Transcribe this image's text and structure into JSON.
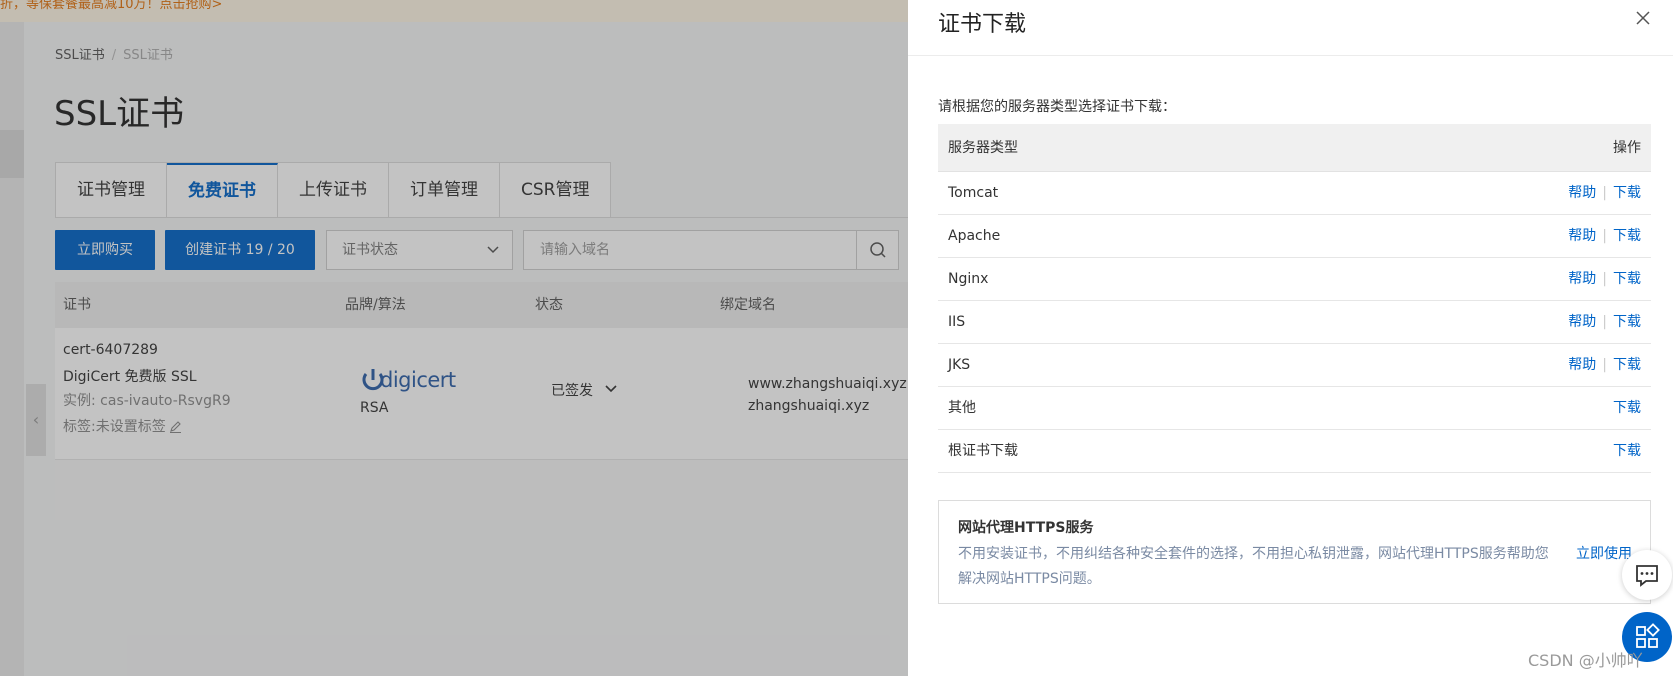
{
  "promo_banner": "折，等保套餐最高减10万！点击抢购>",
  "breadcrumb": {
    "root": "SSL证书",
    "separator": "/",
    "current": "SSL证书"
  },
  "page_title": "SSL证书",
  "tabs": [
    {
      "label": "证书管理",
      "active": false
    },
    {
      "label": "免费证书",
      "active": true
    },
    {
      "label": "上传证书",
      "active": false
    },
    {
      "label": "订单管理",
      "active": false
    },
    {
      "label": "CSR管理",
      "active": false
    }
  ],
  "toolbar": {
    "buy_label": "立即购买",
    "create_label": "创建证书 19 / 20",
    "status_select": "证书状态",
    "search_placeholder": "请输入域名"
  },
  "cert_table": {
    "headers": {
      "cert": "证书",
      "brand": "品牌/算法",
      "status": "状态",
      "domain": "绑定域名"
    },
    "row": {
      "cert_id": "cert-6407289",
      "cert_type": "DigiCert 免费版 SSL",
      "instance": "实例: cas-ivauto-RsvgR9",
      "tag": "标签:未设置标签",
      "brand_logo": "digicert",
      "algorithm": "RSA",
      "status": "已签发",
      "domains": [
        "www.zhangshuaiqi.xyz",
        "zhangshuaiqi.xyz"
      ]
    }
  },
  "drawer": {
    "title": "证书下载",
    "description": "请根据您的服务器类型选择证书下载：",
    "table_headers": {
      "server_type": "服务器类型",
      "action": "操作"
    },
    "help_label": "帮助",
    "download_label": "下载",
    "rows": [
      {
        "name": "Tomcat",
        "help": true
      },
      {
        "name": "Apache",
        "help": true
      },
      {
        "name": "Nginx",
        "help": true
      },
      {
        "name": "IIS",
        "help": true
      },
      {
        "name": "JKS",
        "help": true
      },
      {
        "name": "其他",
        "help": false
      },
      {
        "name": "根证书下载",
        "help": false
      }
    ],
    "proxy_box": {
      "title": "网站代理HTTPS服务",
      "description": "不用安装证书，不用纠结各种安全套件的选择，不用担心私钥泄露，网站代理HTTPS服务帮助您解决网站HTTPS问题。",
      "link": "立即使用"
    }
  },
  "watermark": "CSDN @小帅吖",
  "colors": {
    "primary": "#0064c8",
    "promo_text": "#e4730b"
  }
}
